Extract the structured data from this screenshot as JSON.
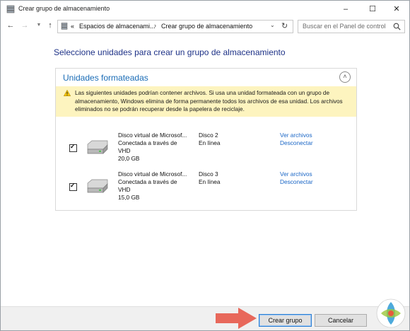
{
  "window": {
    "title": "Crear grupo de almacenamiento"
  },
  "address": {
    "prefix": "«",
    "crumbs": [
      "Espacios de almacenami...",
      "Crear grupo de almacenamiento"
    ],
    "separator": "›",
    "search_placeholder": "Buscar en el Panel de control"
  },
  "main": {
    "heading": "Seleccione unidades para crear un grupo de almacenamiento",
    "group_title": "Unidades formateadas",
    "warning": "Las siguientes unidades podrían contener archivos. Si usa una unidad formateada con un grupo de almacenamiento, Windows elimina de forma permanente todos los archivos de esa unidad. Los archivos eliminados no se podrán recuperar desde la papelera de reciclaje.",
    "disks": [
      {
        "name": "Disco virtual de Microsof...",
        "connection": "Conectada a través de",
        "type": "VHD",
        "size": "20,0 GB",
        "disk_label": "Disco 2",
        "status": "En línea",
        "view_files": "Ver archivos",
        "disconnect": "Desconectar",
        "checked": true
      },
      {
        "name": "Disco virtual de Microsof...",
        "connection": "Conectada a través de",
        "type": "VHD",
        "size": "15,0 GB",
        "disk_label": "Disco 3",
        "status": "En línea",
        "view_files": "Ver archivos",
        "disconnect": "Desconectar",
        "checked": true
      }
    ]
  },
  "footer": {
    "create_label": "Crear grupo",
    "cancel_label": "Cancelar"
  },
  "colors": {
    "heading": "#1e3287",
    "group_title": "#1a6cb6",
    "link": "#1a66c6",
    "warning_bg": "#fdf4bf",
    "arrow": "#e8685b",
    "footer_bg": "#f0f0f0"
  },
  "icons": [
    "storage-pool-icon",
    "back-arrow-icon",
    "forward-arrow-icon",
    "up-arrow-icon",
    "refresh-icon",
    "search-icon",
    "collapse-chevron-icon",
    "warning-icon",
    "drive-icon",
    "pointer-arrow-icon",
    "site-logo-icon"
  ]
}
